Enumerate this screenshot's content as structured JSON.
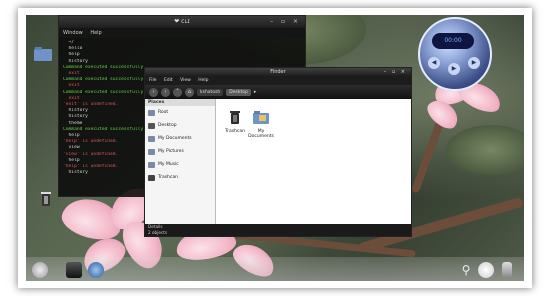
{
  "terminal": {
    "title": "❤ ᴄʟɪ",
    "menu": [
      "Window",
      "Help"
    ],
    "lines": [
      {
        "t": "  ~/",
        "c": "#d9d9d9"
      },
      {
        "t": "  hello",
        "c": "#d9d9d9"
      },
      {
        "t": "  help",
        "c": "#d9d9d9"
      },
      {
        "t": "  history",
        "c": "#d9d9d9"
      },
      {
        "t": "Command executed successfully.",
        "c": "#62d24c"
      },
      {
        "t": "  exit",
        "c": "#e05656"
      },
      {
        "t": "Command executed successfully.",
        "c": "#62d24c"
      },
      {
        "t": "  exit",
        "c": "#e05656"
      },
      {
        "t": "Command executed successfully.",
        "c": "#62d24c"
      },
      {
        "t": "  exit",
        "c": "#e05656"
      },
      {
        "t": "'exit' is undefined.",
        "c": "#e05656"
      },
      {
        "t": "  history",
        "c": "#d9d9d9"
      },
      {
        "t": "  history",
        "c": "#d9d9d9"
      },
      {
        "t": "  theme",
        "c": "#d9d9d9"
      },
      {
        "t": "Command executed successfully.",
        "c": "#62d24c"
      },
      {
        "t": "  help",
        "c": "#d9d9d9"
      },
      {
        "t": "'help' is undefined.",
        "c": "#e05656"
      },
      {
        "t": "  view",
        "c": "#d9d9d9"
      },
      {
        "t": "'view' is undefined.",
        "c": "#e05656"
      },
      {
        "t": "  help",
        "c": "#d9d9d9"
      },
      {
        "t": "'help' is undefined.",
        "c": "#e05656"
      },
      {
        "t": "  history",
        "c": "#d9d9d9"
      }
    ]
  },
  "filemanager": {
    "title": "Finder",
    "menu": [
      "File",
      "Edit",
      "View",
      "Help"
    ],
    "breadcrumbs": [
      "kshatosh",
      "Desktop"
    ],
    "sidebar_header": "Places",
    "sidebar": [
      "Root",
      "Desktop",
      "My Documents",
      "My Pictures",
      "My Music",
      "Trashcan"
    ],
    "files": [
      {
        "name": "Trashcan",
        "icon": "trash-icon"
      },
      {
        "name": "My Documents",
        "icon": "folder-icon"
      }
    ],
    "status_header": "Details",
    "status": "2 objects"
  },
  "player": {
    "display": "00:00"
  },
  "desktop_icons": [
    {
      "name": "Trashcan",
      "icon": "trash-icon"
    }
  ]
}
